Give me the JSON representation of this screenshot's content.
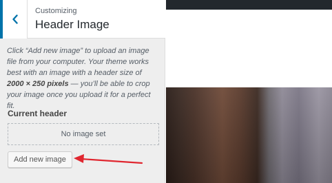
{
  "panel": {
    "customizing_label": "Customizing",
    "title": "Header Image",
    "description_part1": "Click “Add new image” to upload an image file from your computer. Your theme works best with an image with a header size of ",
    "description_size": "2000 × 250 pixels",
    "description_part2": " — you’ll be able to crop your image once you upload it for a perfect fit.",
    "current_header_label": "Current header",
    "placeholder_text": "No image set",
    "add_button_label": "Add new image"
  },
  "icons": {
    "back": "chevron-left-icon",
    "annotation": "arrow-icon"
  },
  "colors": {
    "accent": "#0073aa",
    "annotation_arrow": "#e0262f",
    "preview_topbar": "#23282d"
  }
}
